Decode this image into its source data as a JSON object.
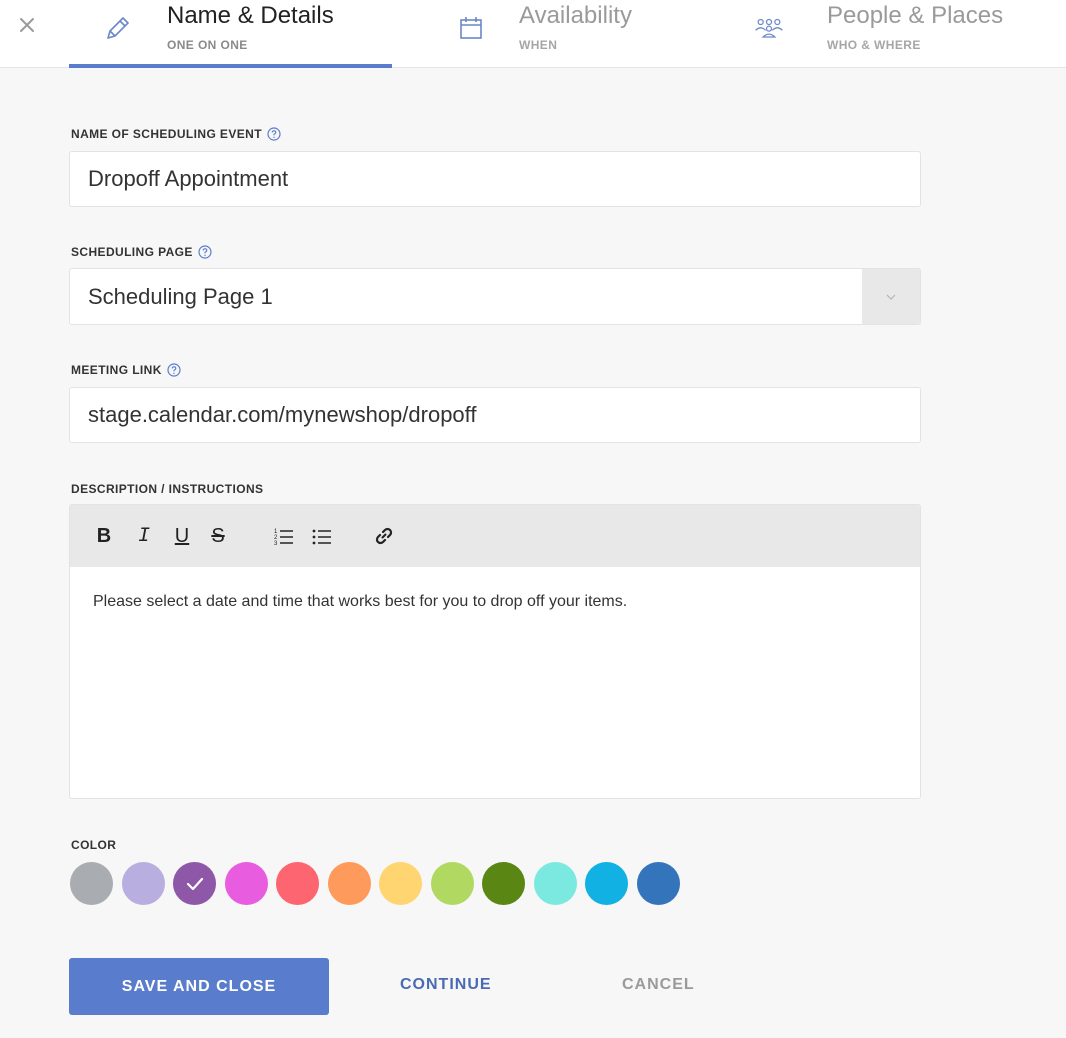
{
  "tabs": [
    {
      "title": "Name & Details",
      "subtitle": "ONE ON ONE",
      "icon": "pencil-icon",
      "active": true
    },
    {
      "title": "Availability",
      "subtitle": "WHEN",
      "icon": "calendar-icon",
      "active": false
    },
    {
      "title": "People & Places",
      "subtitle": "WHO & WHERE",
      "icon": "people-icon",
      "active": false
    }
  ],
  "form": {
    "event_name": {
      "label": "NAME OF SCHEDULING EVENT",
      "value": "Dropoff Appointment"
    },
    "scheduling_page": {
      "label": "SCHEDULING PAGE",
      "value": "Scheduling Page 1"
    },
    "meeting_link": {
      "label": "MEETING LINK",
      "value": "stage.calendar.com/mynewshop/dropoff"
    },
    "description": {
      "label": "DESCRIPTION / INSTRUCTIONS",
      "toolbar": {
        "bold": "B",
        "italic": "I",
        "underline": "U",
        "strike": "S"
      },
      "value": "Please select a date and time that works best for you to drop off your items."
    },
    "color": {
      "label": "COLOR",
      "swatches": [
        "#a9acb1",
        "#b8aee0",
        "#8e57a8",
        "#e85de0",
        "#fd6671",
        "#fe9a5c",
        "#ffd572",
        "#b1d962",
        "#5a8714",
        "#7ce9e1",
        "#11b1e3",
        "#3474bb"
      ],
      "selected_index": 2
    }
  },
  "actions": {
    "save": "SAVE AND CLOSE",
    "continue": "CONTINUE",
    "cancel": "CANCEL"
  },
  "colors": {
    "accent": "#5a7ccc",
    "link": "#4a6ab4",
    "muted": "#9a9a9a"
  }
}
